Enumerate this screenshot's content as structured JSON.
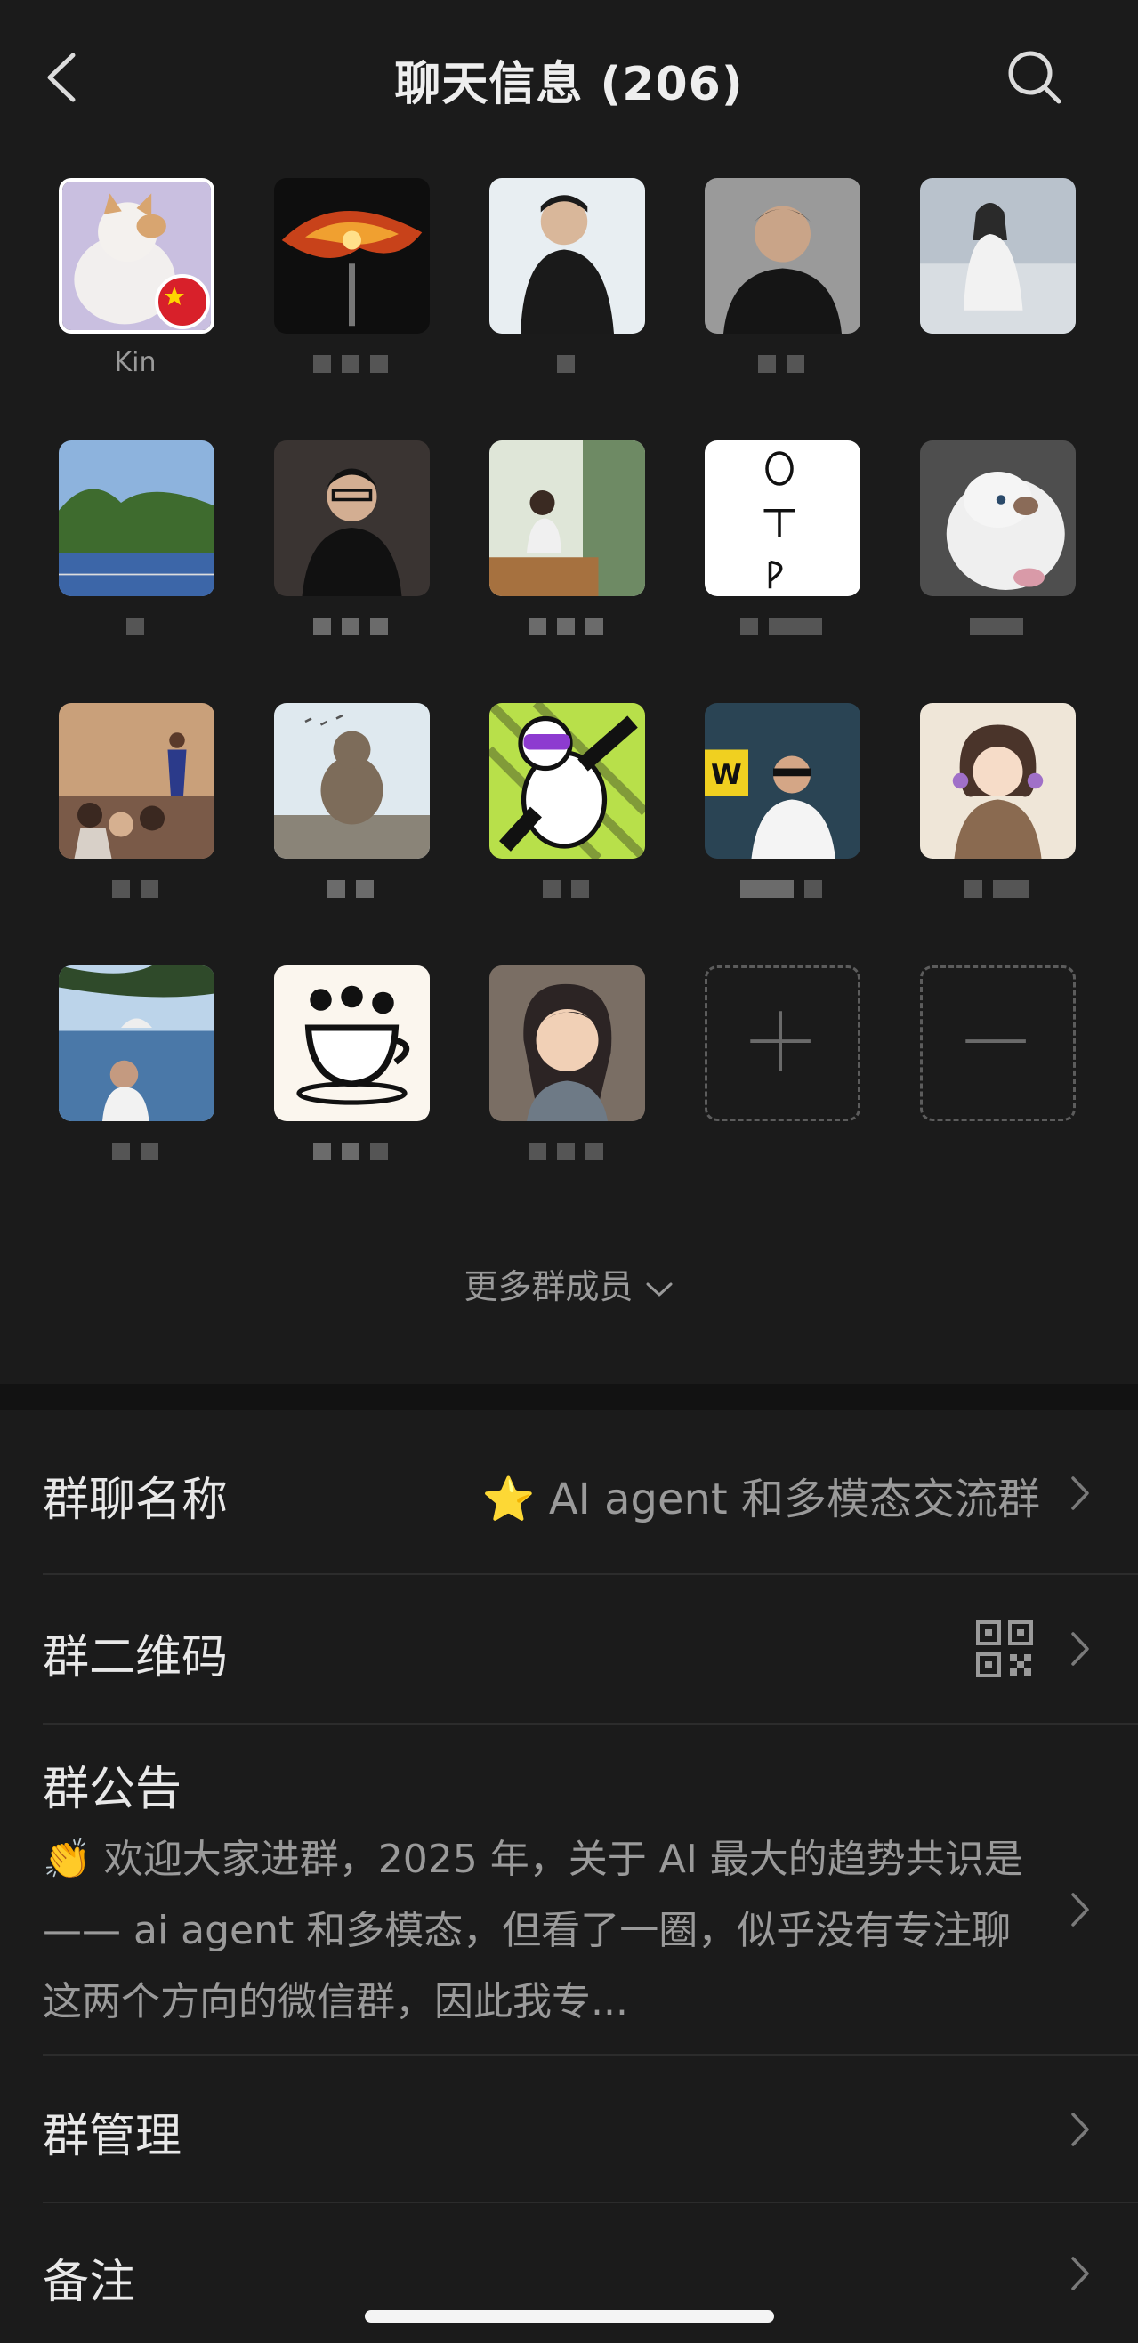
{
  "header": {
    "title": "聊天信息 (206)"
  },
  "members": [
    {
      "name": "Kin"
    },
    {
      "name": ""
    },
    {
      "name": ""
    },
    {
      "name": ""
    },
    {
      "name": ""
    },
    {
      "name": ""
    },
    {
      "name": ""
    },
    {
      "name": ""
    },
    {
      "name": ""
    },
    {
      "name": ""
    },
    {
      "name": ""
    },
    {
      "name": ""
    },
    {
      "name": ""
    },
    {
      "name": ""
    },
    {
      "name": ""
    },
    {
      "name": ""
    },
    {
      "name": ""
    },
    {
      "name": ""
    }
  ],
  "member_actions": {
    "add": "+",
    "remove": "−"
  },
  "more_members": {
    "label": "更多群成员"
  },
  "settings": {
    "group_name": {
      "label": "群聊名称",
      "emoji": "⭐",
      "value": "AI agent 和多模态交流群"
    },
    "qr_code": {
      "label": "群二维码"
    },
    "announcement": {
      "label": "群公告",
      "emoji": "👏",
      "text": "欢迎大家进群，2025 年，关于 AI 最大的趋势共识是 —— ai agent 和多模态，但看了一圈，似乎没有专注聊这两个方向的微信群，因此我专..."
    },
    "group_manage": {
      "label": "群管理"
    },
    "remark": {
      "label": "备注"
    }
  },
  "colors": {
    "background": "#1b1b1b",
    "band": "#121212",
    "text_primary": "#e8e8e8",
    "text_secondary": "#9a9a9a"
  }
}
